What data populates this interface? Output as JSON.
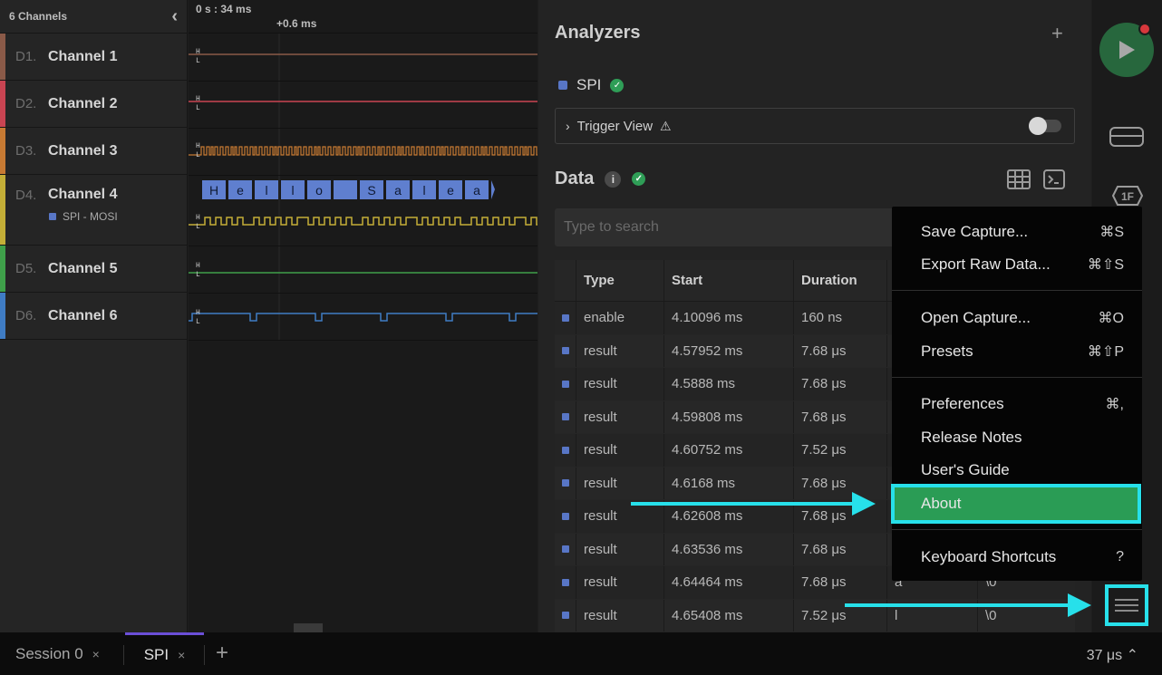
{
  "channels_header": {
    "title": "6 Channels"
  },
  "channels": [
    {
      "id": "D1.",
      "name": "Channel 1",
      "color": "#8a5a48"
    },
    {
      "id": "D2.",
      "name": "Channel 2",
      "color": "#c94452"
    },
    {
      "id": "D3.",
      "name": "Channel 3",
      "color": "#c77a33"
    },
    {
      "id": "D4.",
      "name": "Channel 4",
      "color": "#c4ae37",
      "sub": "SPI - MOSI"
    },
    {
      "id": "D5.",
      "name": "Channel 5",
      "color": "#3fa04a"
    },
    {
      "id": "D6.",
      "name": "Channel 6",
      "color": "#3f7cc4"
    }
  ],
  "timeline": {
    "absolute": "0 s : 34 ms",
    "relative": "+0.6 ms"
  },
  "spi_decode": [
    "H",
    "e",
    "l",
    "l",
    "o",
    "",
    "S",
    "a",
    "l",
    "e",
    "a"
  ],
  "analyzers": {
    "title": "Analyzers",
    "add": "+",
    "spi": {
      "label": "SPI"
    },
    "trigger": {
      "label": "Trigger View",
      "warning": "⚠",
      "enabled": false
    }
  },
  "data": {
    "title": "Data",
    "search_placeholder": "Type to search",
    "columns": [
      "",
      "Type",
      "Start",
      "Duration",
      "",
      ""
    ],
    "rows": [
      {
        "type": "enable",
        "start": "4.10096 ms",
        "duration": "160 ns",
        "mosi": "",
        "miso": ""
      },
      {
        "type": "result",
        "start": "4.57952 ms",
        "duration": "7.68 μs",
        "mosi": "",
        "miso": ""
      },
      {
        "type": "result",
        "start": "4.5888 ms",
        "duration": "7.68 μs",
        "mosi": "",
        "miso": ""
      },
      {
        "type": "result",
        "start": "4.59808 ms",
        "duration": "7.68 μs",
        "mosi": "",
        "miso": ""
      },
      {
        "type": "result",
        "start": "4.60752 ms",
        "duration": "7.52 μs",
        "mosi": "",
        "miso": ""
      },
      {
        "type": "result",
        "start": "4.6168 ms",
        "duration": "7.68 μs",
        "mosi": "",
        "miso": ""
      },
      {
        "type": "result",
        "start": "4.62608 ms",
        "duration": "7.68 μs",
        "mosi": "",
        "miso": ""
      },
      {
        "type": "result",
        "start": "4.63536 ms",
        "duration": "7.68 μs",
        "mosi": "",
        "miso": ""
      },
      {
        "type": "result",
        "start": "4.64464 ms",
        "duration": "7.68 μs",
        "mosi": "a",
        "miso": "\\0"
      },
      {
        "type": "result",
        "start": "4.65408 ms",
        "duration": "7.52 μs",
        "mosi": "l",
        "miso": "\\0"
      }
    ]
  },
  "menu": {
    "items": [
      {
        "label": "Save Capture...",
        "shortcut": "⌘S"
      },
      {
        "label": "Export Raw Data...",
        "shortcut": "⌘⇧S"
      },
      {
        "label": "Open Capture...",
        "shortcut": "⌘O"
      },
      {
        "label": "Presets",
        "shortcut": "⌘⇧P"
      },
      {
        "label": "Preferences",
        "shortcut": "⌘,"
      },
      {
        "label": "Release Notes",
        "shortcut": ""
      },
      {
        "label": "User's Guide",
        "shortcut": ""
      },
      {
        "label": "About",
        "shortcut": ""
      },
      {
        "label": "Keyboard Shortcuts",
        "shortcut": "?"
      }
    ]
  },
  "sidebar": {
    "hex_label": "1F"
  },
  "tabs": {
    "items": [
      {
        "label": "Session 0",
        "close": "×"
      },
      {
        "label": "SPI",
        "close": "×"
      }
    ],
    "add": "+",
    "zoom": "37 μs ⌃"
  }
}
